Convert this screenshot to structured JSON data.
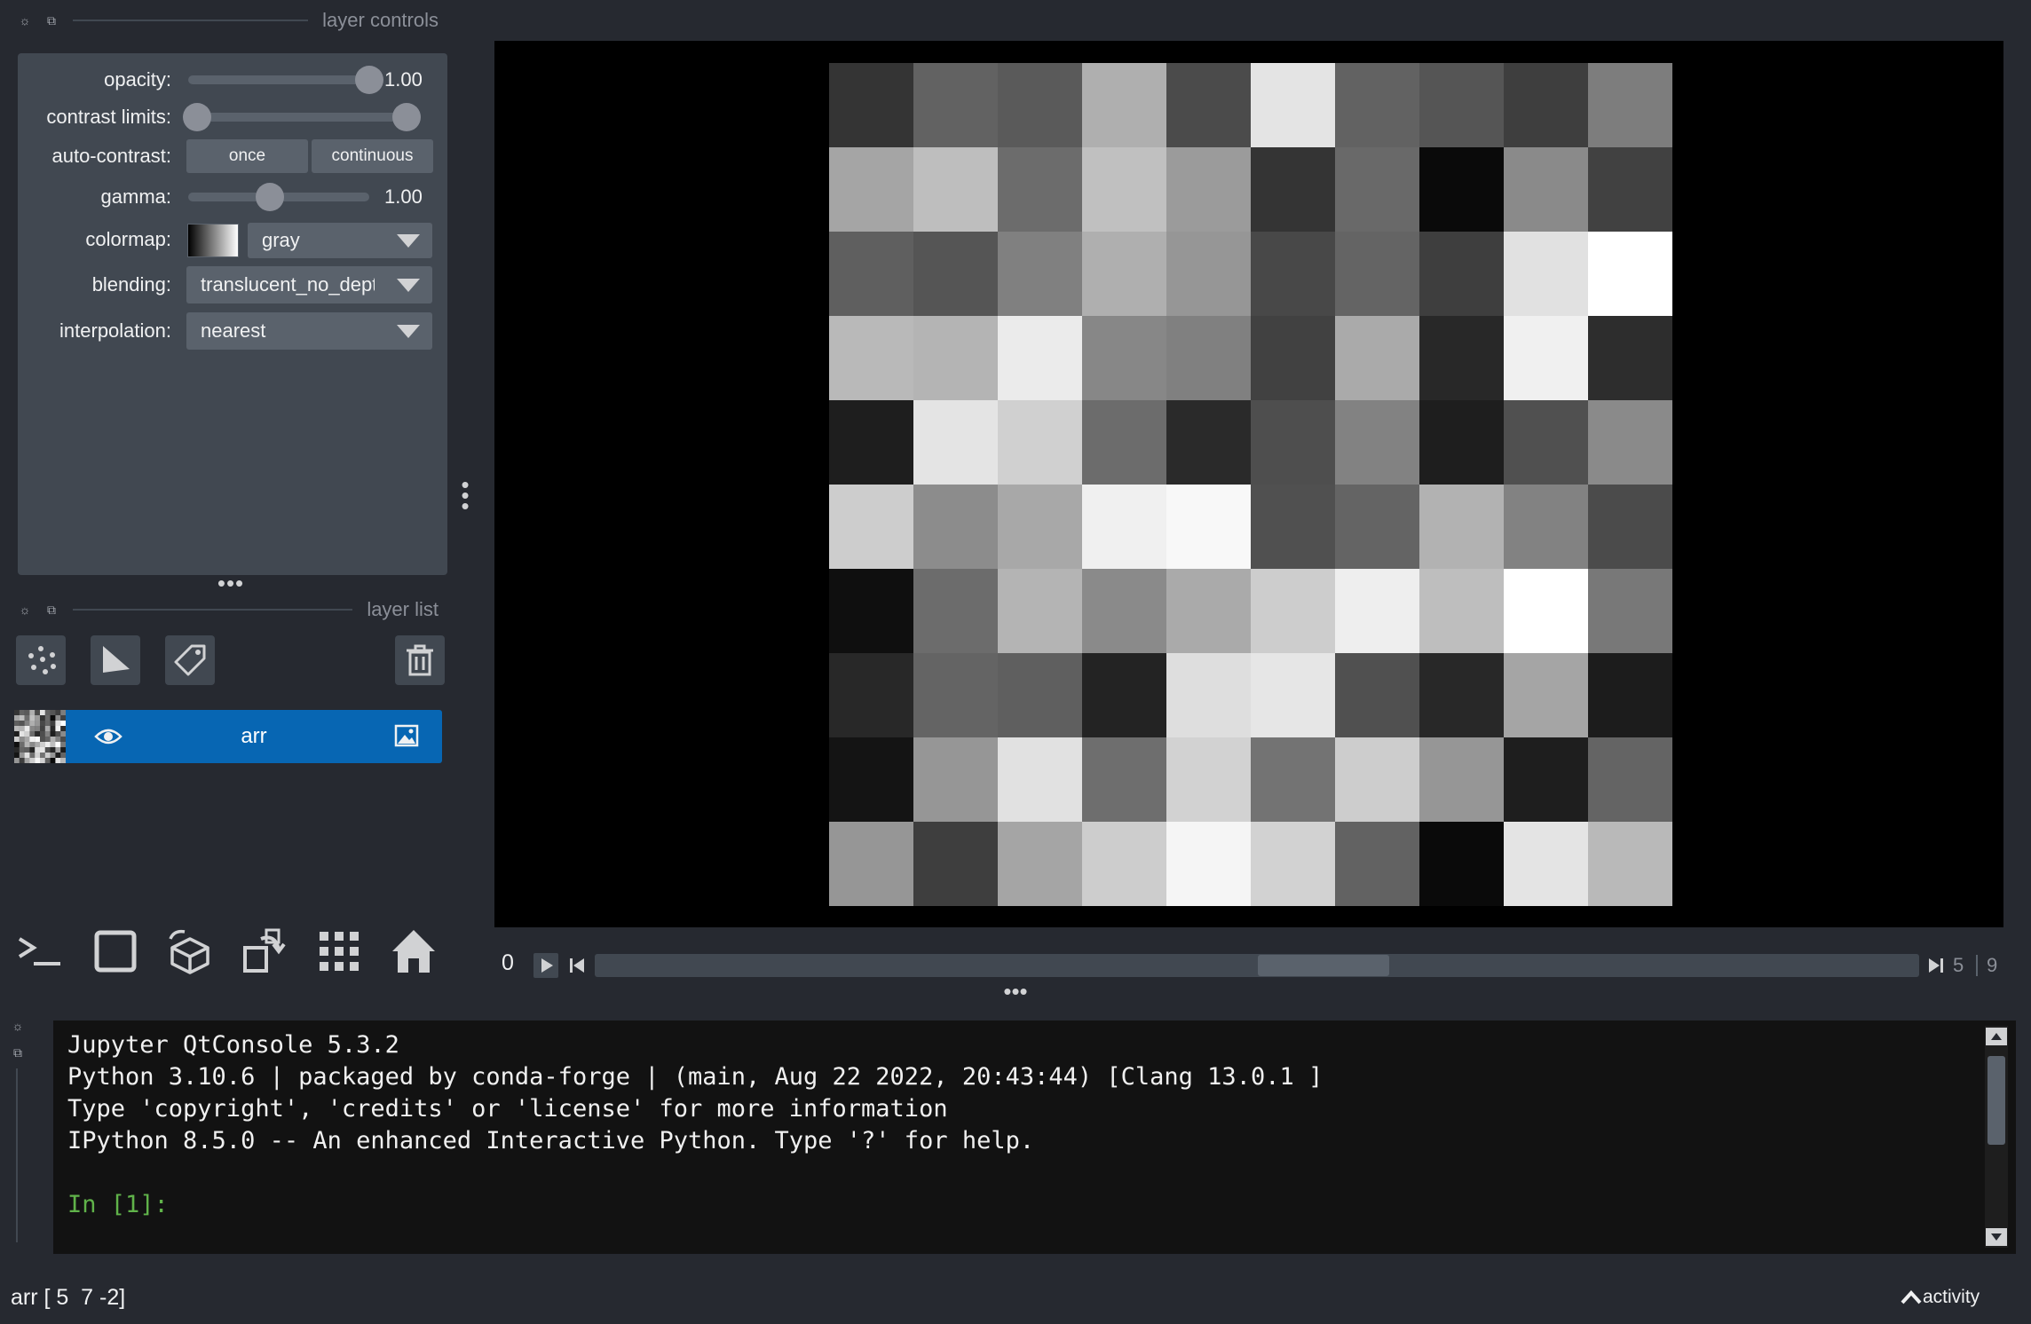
{
  "layer_controls": {
    "title": "layer controls",
    "opacity_label": "opacity:",
    "opacity_value": "1.00",
    "opacity_level": 1.0,
    "contrast_label": "contrast limits:",
    "contrast_range": [
      0.0,
      1.0
    ],
    "auto_contrast_label": "auto-contrast:",
    "once_label": "once",
    "continuous_label": "continuous",
    "gamma_label": "gamma:",
    "gamma_value": "1.00",
    "gamma_level": 0.45,
    "colormap_label": "colormap:",
    "colormap_value": "gray",
    "blending_label": "blending:",
    "blending_value": "translucent_no_depth",
    "interpolation_label": "interpolation:",
    "interpolation_value": "nearest"
  },
  "layer_list": {
    "title": "layer list",
    "layers": [
      {
        "name": "arr",
        "icon": "image-icon",
        "selected": true
      }
    ]
  },
  "icons": {
    "points": "points-icon",
    "shapes": "shapes-icon",
    "labels": "labels-icon",
    "delete": "trash-icon",
    "console": "console-icon",
    "ndisplay": "square-icon",
    "roll": "cube-icon",
    "transpose": "transpose-icon",
    "grid": "grid-icon",
    "home": "home-icon"
  },
  "image_grid": [
    [
      52,
      98,
      90,
      175,
      75,
      228,
      98,
      85,
      62,
      125
    ],
    [
      165,
      190,
      108,
      192,
      155,
      52,
      105,
      10,
      138,
      65
    ],
    [
      95,
      85,
      128,
      175,
      150,
      72,
      100,
      62,
      225,
      255
    ],
    [
      185,
      180,
      235,
      135,
      128,
      65,
      170,
      40,
      240,
      45
    ],
    [
      30,
      228,
      208,
      108,
      42,
      78,
      130,
      30,
      80,
      138
    ],
    [
      205,
      140,
      168,
      240,
      248,
      80,
      100,
      178,
      130,
      75
    ],
    [
      15,
      108,
      180,
      138,
      170,
      205,
      238,
      190,
      255,
      120
    ],
    [
      40,
      100,
      95,
      35,
      222,
      230,
      80,
      40,
      165,
      28
    ],
    [
      20,
      150,
      225,
      110,
      210,
      115,
      205,
      150,
      30,
      100
    ],
    [
      150,
      62,
      165,
      205,
      245,
      210,
      98,
      10,
      228,
      185
    ]
  ],
  "dims_slider": {
    "current_label": "0",
    "position": 5,
    "max": 9,
    "position_label": "5",
    "max_label": "9"
  },
  "console": {
    "lines": [
      "Jupyter QtConsole 5.3.2",
      "Python 3.10.6 | packaged by conda-forge | (main, Aug 22 2022, 20:43:44) [Clang 13.0.1 ]",
      "Type 'copyright', 'credits' or 'license' for more information",
      "IPython 8.5.0 -- An enhanced Interactive Python. Type '?' for help."
    ],
    "prompt": "In [1]:"
  },
  "status": {
    "text": "arr [ 5  7 -2]",
    "activity_label": "activity"
  },
  "colors": {
    "background": "#262930",
    "panel": "#414851",
    "widget": "#5a626c",
    "selected_layer": "#0766b3",
    "prompt_green": "#60b34a"
  }
}
